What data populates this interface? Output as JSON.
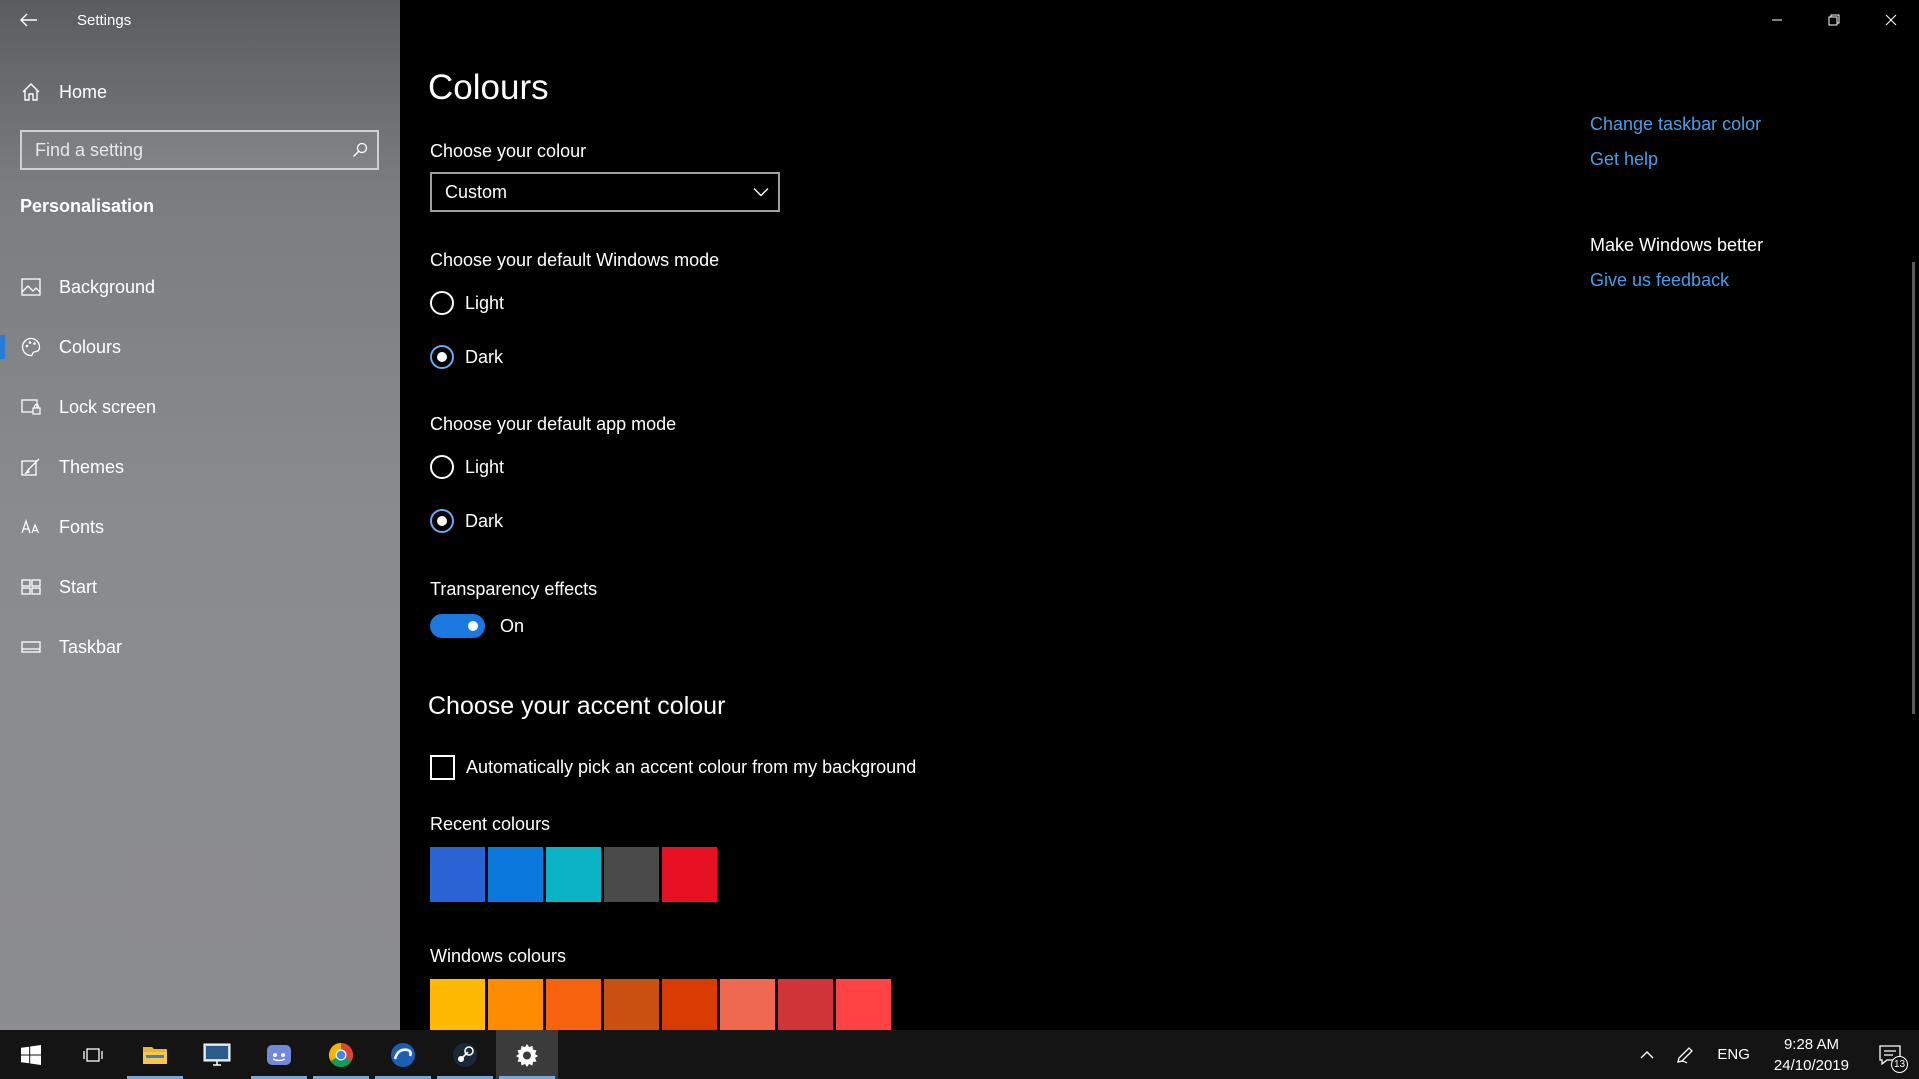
{
  "window": {
    "title": "Settings"
  },
  "sidebar": {
    "home_label": "Home",
    "search_placeholder": "Find a setting",
    "section_title": "Personalisation",
    "items": [
      {
        "label": "Background",
        "icon": "picture-icon"
      },
      {
        "label": "Colours",
        "icon": "palette-icon",
        "active": true
      },
      {
        "label": "Lock screen",
        "icon": "lock-screen-icon"
      },
      {
        "label": "Themes",
        "icon": "themes-icon"
      },
      {
        "label": "Fonts",
        "icon": "fonts-icon"
      },
      {
        "label": "Start",
        "icon": "start-icon"
      },
      {
        "label": "Taskbar",
        "icon": "taskbar-icon"
      }
    ]
  },
  "main": {
    "title": "Colours",
    "choose_colour_label": "Choose your colour",
    "choose_colour_value": "Custom",
    "windows_mode_label": "Choose your default Windows mode",
    "windows_mode_options": [
      "Light",
      "Dark"
    ],
    "windows_mode_selected": "Dark",
    "app_mode_label": "Choose your default app mode",
    "app_mode_options": [
      "Light",
      "Dark"
    ],
    "app_mode_selected": "Dark",
    "transparency_label": "Transparency effects",
    "transparency_state": "On",
    "accent_heading": "Choose your accent colour",
    "auto_accent_label": "Automatically pick an accent colour from my background",
    "recent_colours_label": "Recent colours",
    "recent_colours": [
      "#2a63d4",
      "#0a78dc",
      "#0ab4c4",
      "#4a4a4a",
      "#e81123"
    ],
    "windows_colours_label": "Windows colours",
    "windows_colours": [
      "#ffb900",
      "#ff8c00",
      "#f7630c",
      "#ca5010",
      "#da3b01",
      "#ef6950",
      "#d13438",
      "#ff4343"
    ]
  },
  "related": {
    "change_taskbar": "Change taskbar color",
    "get_help": "Get help",
    "make_better": "Make Windows better",
    "feedback": "Give us feedback"
  },
  "taskbar": {
    "apps": [
      {
        "name": "start-button",
        "icon": "windows-logo-icon"
      },
      {
        "name": "task-view-button",
        "icon": "task-view-icon"
      },
      {
        "name": "file-explorer-button",
        "icon": "folder-icon",
        "open": true
      },
      {
        "name": "remote-desktop-button",
        "icon": "monitor-icon"
      },
      {
        "name": "discord-button",
        "icon": "discord-icon",
        "open": true
      },
      {
        "name": "chrome-button",
        "icon": "chrome-icon",
        "open": true
      },
      {
        "name": "edge-like-button",
        "icon": "browser-icon",
        "open": true
      },
      {
        "name": "steam-button",
        "icon": "steam-icon",
        "open": true
      },
      {
        "name": "settings-button",
        "icon": "gear-icon",
        "open": true,
        "active": true
      }
    ],
    "language": "ENG",
    "time": "9:28 AM",
    "date": "24/10/2019",
    "notification_count": "13"
  },
  "colors": {
    "accent": "#1a78e0",
    "link": "#4a9ee8"
  }
}
